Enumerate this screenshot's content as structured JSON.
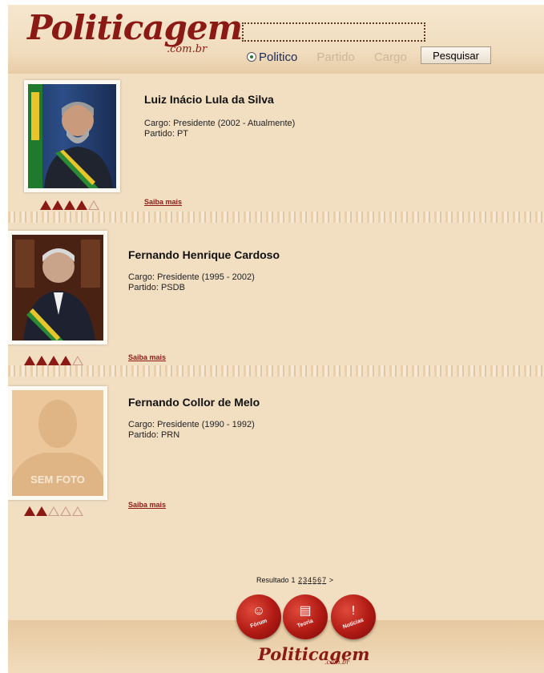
{
  "header": {
    "logo_text": "Politicagem",
    "logo_sub": ".com.br",
    "search_value": "",
    "radio_options": [
      "Politico",
      "Partido",
      "Cargo"
    ],
    "search_button": "Pesquisar"
  },
  "results": [
    {
      "name": "Luiz Inácio Lula da Silva",
      "cargo": "Cargo: Presidente (2002 - Atualmente)",
      "partido": "Partido: PT",
      "saiba": "Saiba mais",
      "rating": 4,
      "rating_max": 5
    },
    {
      "name": "Fernando Henrique Cardoso",
      "cargo": "Cargo: Presidente (1995 - 2002)",
      "partido": "Partido: PSDB",
      "saiba": "Saiba mais",
      "rating": 4,
      "rating_max": 5
    },
    {
      "name": "Fernando Collor de Melo",
      "cargo": "Cargo: Presidente (1990 - 1992)",
      "partido": "Partido: PRN",
      "saiba": "Saiba mais",
      "rating": 2,
      "rating_max": 5,
      "photo_placeholder": "SEM FOTO"
    }
  ],
  "pagination": {
    "label": "Resultado",
    "pages": [
      "1",
      "2",
      "3",
      "4",
      "5",
      "6",
      "7"
    ],
    "current": "1",
    "next": ">"
  },
  "footer": {
    "seals": [
      {
        "label": "Fórum",
        "icon": "people-icon"
      },
      {
        "label": "Teoria",
        "icon": "document-icon"
      },
      {
        "label": "Notícias",
        "icon": "exclamation-icon"
      }
    ],
    "logo_text": "Politicagem",
    "logo_sub": ".com.br"
  },
  "colors": {
    "brand": "#8c1a14",
    "paper": "#f2dfc2"
  }
}
